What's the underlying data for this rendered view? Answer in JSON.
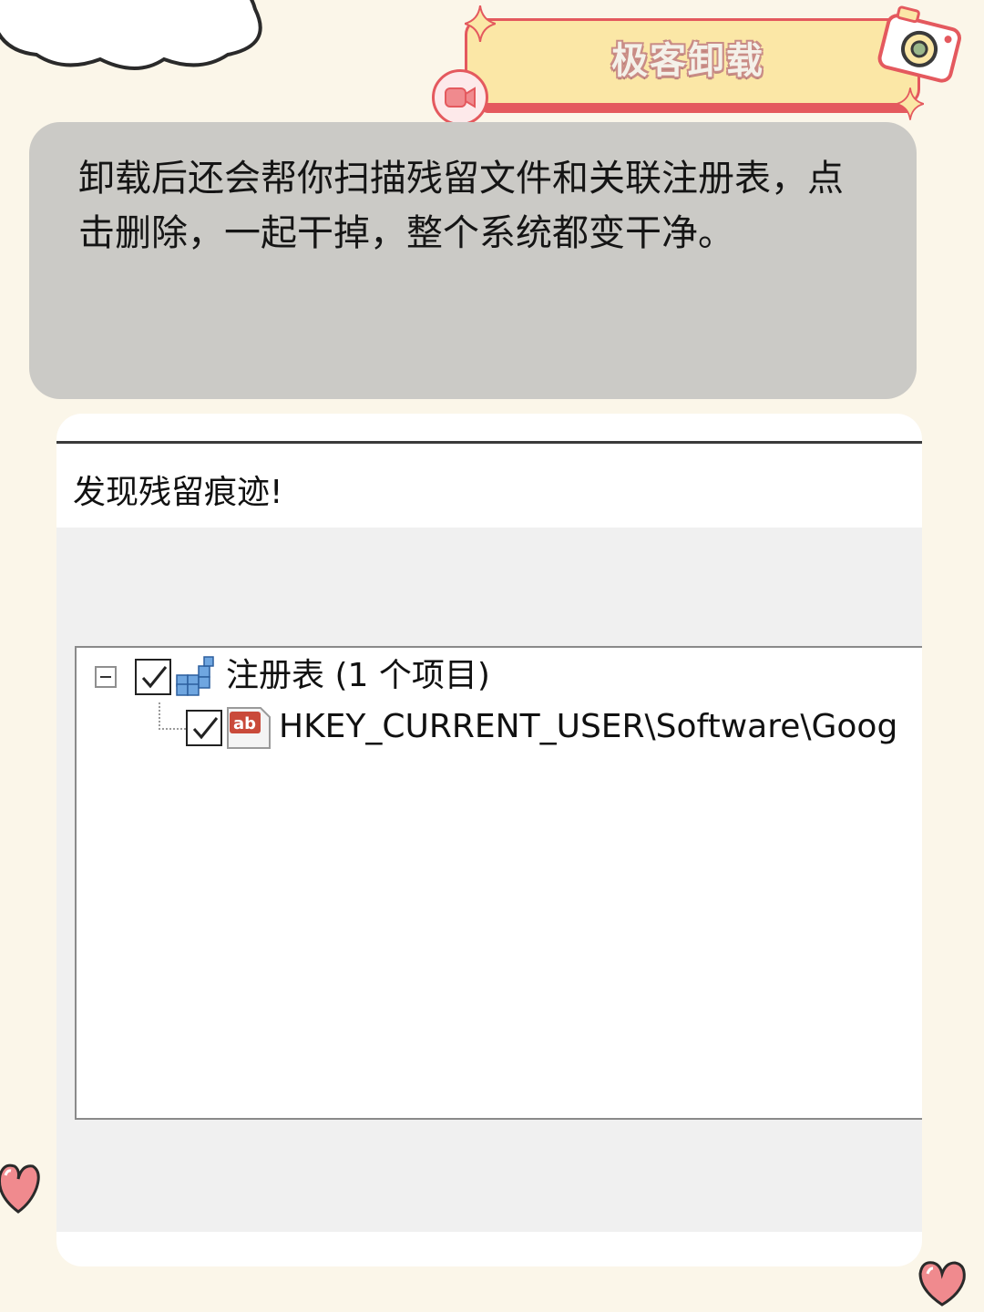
{
  "banner": {
    "title": "极客卸载"
  },
  "speech": {
    "text": "卸载后还会帮你扫描残留文件和关联注册表，点击删除，一起干掉，整个系统都变干净。"
  },
  "dialog": {
    "title": "发现残留痕迹!",
    "tree": [
      {
        "label": "注册表 (1 个项目)",
        "checked": true,
        "expanded": true,
        "icon": "registry-icon"
      },
      {
        "label": "HKEY_CURRENT_USER\\Software\\Goog",
        "checked": true,
        "icon": "registry-value-icon"
      }
    ]
  },
  "colors": {
    "accent": "#e4595e",
    "banner_fill": "#fbe7a6",
    "panel": "#cbcac6",
    "page": "#fbf6e9"
  }
}
